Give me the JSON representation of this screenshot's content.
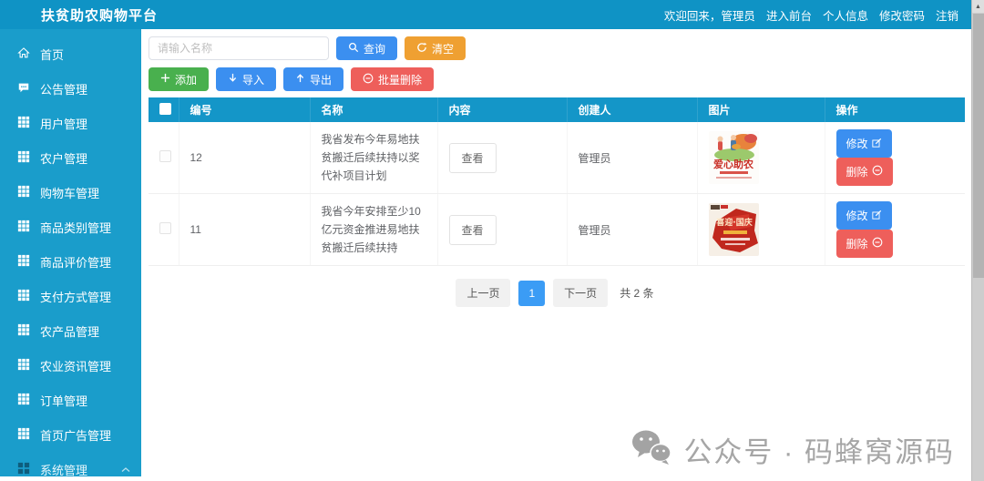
{
  "topbar": {
    "title": "扶贫助农购物平台",
    "links": [
      {
        "label": "欢迎回来，管理员"
      },
      {
        "label": "进入前台"
      },
      {
        "label": "个人信息"
      },
      {
        "label": "修改密码"
      },
      {
        "label": "注销"
      }
    ]
  },
  "sidebar": {
    "items": [
      {
        "label": "首页",
        "icon": "home-icon"
      },
      {
        "label": "公告管理",
        "icon": "comment-icon"
      },
      {
        "label": "用户管理",
        "icon": "grid-icon"
      },
      {
        "label": "农户管理",
        "icon": "grid-icon"
      },
      {
        "label": "购物车管理",
        "icon": "grid-icon"
      },
      {
        "label": "商品类别管理",
        "icon": "grid-icon"
      },
      {
        "label": "商品评价管理",
        "icon": "grid-icon"
      },
      {
        "label": "支付方式管理",
        "icon": "grid-icon"
      },
      {
        "label": "农产品管理",
        "icon": "grid-icon"
      },
      {
        "label": "农业资讯管理",
        "icon": "grid-icon"
      },
      {
        "label": "订单管理",
        "icon": "grid-icon"
      },
      {
        "label": "首页广告管理",
        "icon": "grid-icon"
      },
      {
        "label": "系统管理",
        "icon": "th-large-icon",
        "chevron": "up"
      }
    ]
  },
  "toolbar": {
    "search_placeholder": "请输入名称",
    "query_label": "查询",
    "clear_label": "清空",
    "add_label": "添加",
    "import_label": "导入",
    "export_label": "导出",
    "batch_delete_label": "批量删除"
  },
  "table": {
    "headers": [
      "编号",
      "名称",
      "内容",
      "创建人",
      "图片",
      "操作"
    ],
    "rows": [
      {
        "id": "12",
        "name": "我省发布今年易地扶贫搬迁后续扶持以奖代补项目计划",
        "view_label": "查看",
        "creator": "管理员",
        "edit_label": "修改",
        "delete_label": "删除"
      },
      {
        "id": "11",
        "name": "我省今年安排至少10亿元资金推进易地扶贫搬迁后续扶持",
        "view_label": "查看",
        "creator": "管理员",
        "edit_label": "修改",
        "delete_label": "删除"
      }
    ]
  },
  "pagination": {
    "prev_label": "上一页",
    "current_page": "1",
    "next_label": "下一页",
    "total_text": "共 2 条"
  },
  "watermark": {
    "text": "公众号 · 码蜂窝源码"
  },
  "colors": {
    "primary": "#1496c8",
    "button_blue": "#3b8ff0",
    "button_green": "#49b04e",
    "button_orange": "#efa032",
    "button_red": "#ee5f5b"
  }
}
